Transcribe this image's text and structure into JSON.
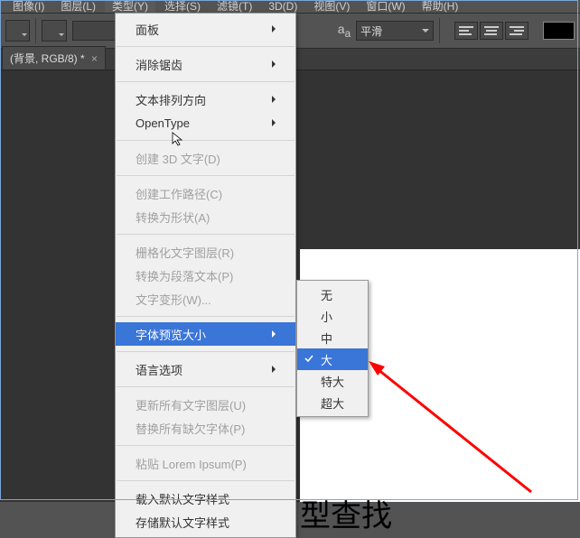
{
  "menubar": {
    "items": [
      "图像(I)",
      "图层(L)",
      "类型(Y)",
      "选择(S)",
      "滤镜(T)",
      "3D(D)",
      "视图(V)",
      "窗口(W)",
      "帮助(H)"
    ]
  },
  "optionsbar": {
    "aa_letter": "a",
    "aa_sub": "a",
    "smoothing": "平滑"
  },
  "tab": {
    "title": "(背景, RGB/8) *",
    "close": "×"
  },
  "dropdown": {
    "panel": "面板",
    "antialias": "消除锯齿",
    "textdir": "文本排列方向",
    "opentype": "OpenType",
    "create3d": "创建 3D 文字(D)",
    "workpath": "创建工作路径(C)",
    "toshape": "转换为形状(A)",
    "rasterize": "栅格化文字图层(R)",
    "toparagraph": "转换为段落文本(P)",
    "warp": "文字变形(W)...",
    "fontpreview": "字体预览大小",
    "language": "语言选项",
    "updatelayers": "更新所有文字图层(U)",
    "replacemissing": "替换所有缺欠字体(P)",
    "lorem": "粘贴 Lorem Ipsum(P)",
    "loaddefault": "载入默认文字样式",
    "savedefault": "存储默认文字样式"
  },
  "submenu": {
    "none": "无",
    "small": "小",
    "medium": "中",
    "large": "大",
    "xlarge": "特大",
    "xxlarge": "超大"
  },
  "doc": {
    "text": "型查找"
  }
}
